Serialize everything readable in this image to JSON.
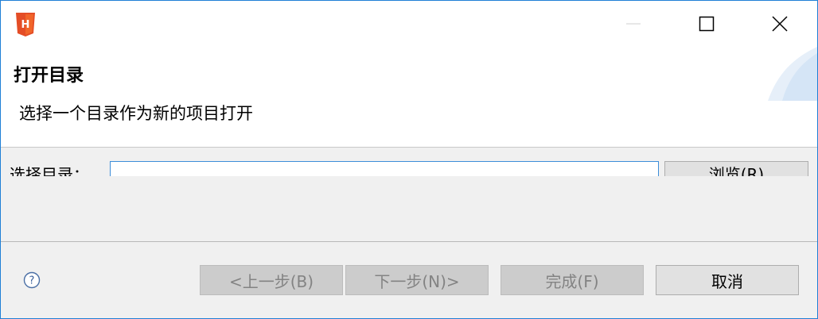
{
  "window": {
    "controls": {
      "minimize_icon": "minimize-icon",
      "maximize_icon": "maximize-icon",
      "close_icon": "close-icon"
    },
    "app_icon": "hbuilder-logo-icon",
    "accent_color": "#1f7fd6"
  },
  "header": {
    "title": "打开目录",
    "description": "选择一个目录作为新的项目打开"
  },
  "form": {
    "directory_label": "选择目录：",
    "directory_value": "",
    "browse_label": "浏览(R)"
  },
  "footer": {
    "help_icon": "help-icon",
    "back_label": "<上一步(B)",
    "next_label": "下一步(N)>",
    "finish_label": "完成(F)",
    "cancel_label": "取消"
  }
}
